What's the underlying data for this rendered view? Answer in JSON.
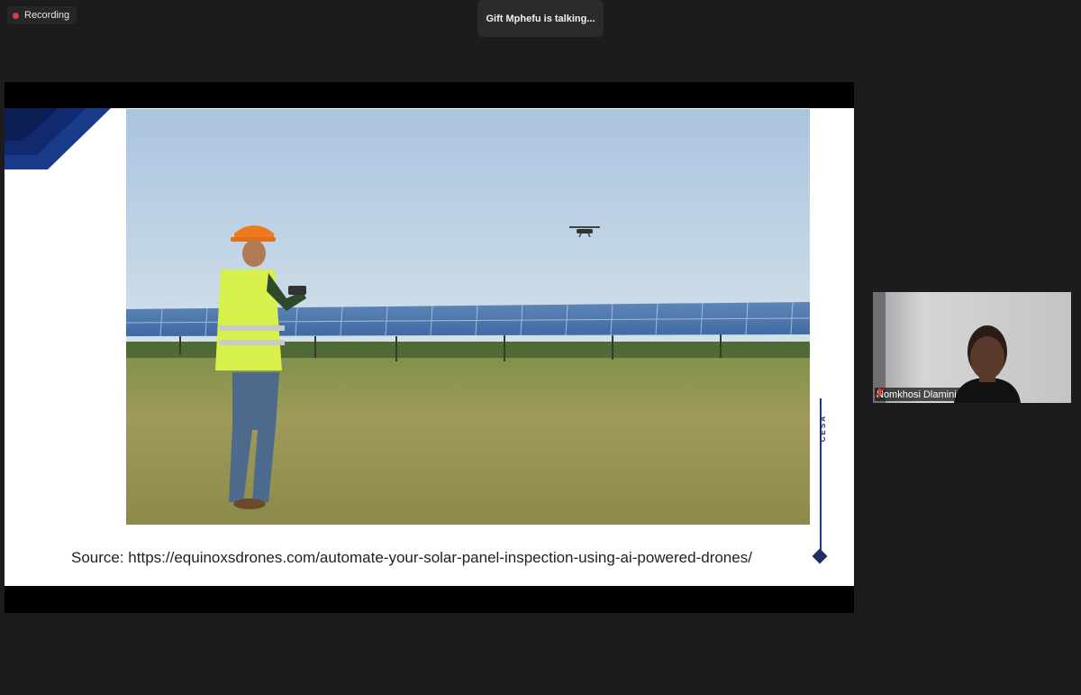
{
  "recording": {
    "label": "Recording",
    "dot_color": "#e23b3b"
  },
  "talking_indicator": {
    "text": "Gift Mphefu is talking..."
  },
  "slide": {
    "source_text": "Source: https://equinoxsdrones.com/automate-your-solar-panel-inspection-using-ai-powered-drones/",
    "side_label": "CESA",
    "accent_color": "#1f3b7a"
  },
  "participant": {
    "name": "Nomkhosi Dlamini",
    "muted": true,
    "mic_icon": "mic-muted-icon"
  }
}
